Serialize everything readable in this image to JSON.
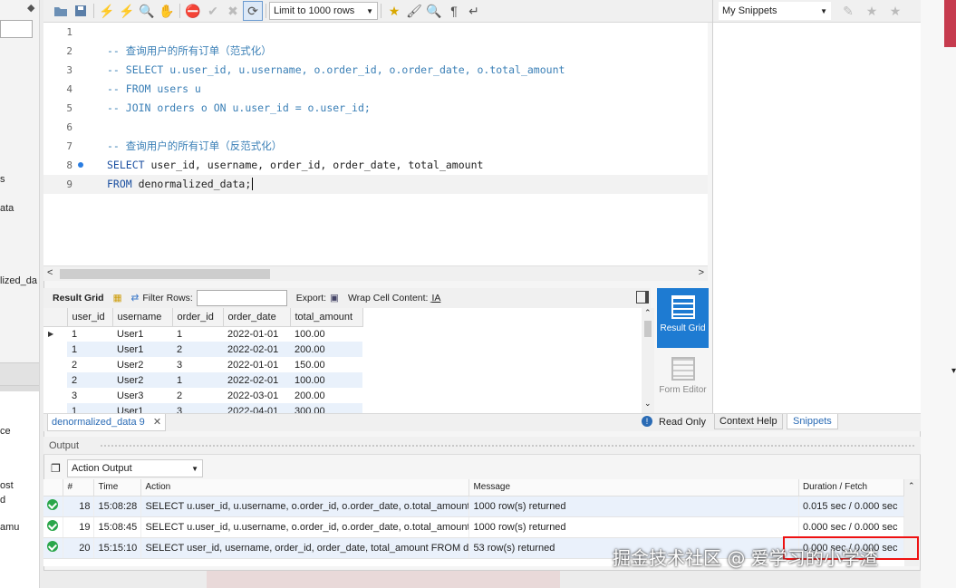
{
  "left_fragments": [
    "s",
    "ata",
    "lized_da",
    "ce",
    "ost",
    "d",
    "amu"
  ],
  "toolbar": {
    "limit_select": "Limit to 1000 rows",
    "snippets_select": "My Snippets"
  },
  "editor": {
    "lines": [
      {
        "n": "1",
        "text": "",
        "type": "plain"
      },
      {
        "n": "2",
        "text": "-- 查询用户的所有订单（范式化）",
        "type": "comment"
      },
      {
        "n": "3",
        "text": "-- SELECT u.user_id, u.username, o.order_id, o.order_date, o.total_amount",
        "type": "comment"
      },
      {
        "n": "4",
        "text": "-- FROM users u",
        "type": "comment"
      },
      {
        "n": "5",
        "text": "-- JOIN orders o ON u.user_id = o.user_id;",
        "type": "comment"
      },
      {
        "n": "6",
        "text": "",
        "type": "plain"
      },
      {
        "n": "7",
        "text": "-- 查询用户的所有订单（反范式化）",
        "type": "comment"
      },
      {
        "n": "8",
        "kw": "SELECT",
        "text": " user_id, username, order_id, order_date, total_amount",
        "type": "sql"
      },
      {
        "n": "9",
        "kw": "FROM",
        "text": " denormalized_data;",
        "type": "sql"
      }
    ]
  },
  "result_bar": {
    "result_grid": "Result Grid",
    "filter_rows": "Filter Rows:",
    "export": "Export:",
    "wrap": "Wrap Cell Content:"
  },
  "grid": {
    "columns": [
      "user_id",
      "username",
      "order_id",
      "order_date",
      "total_amount"
    ],
    "rows": [
      [
        "1",
        "User1",
        "1",
        "2022-01-01",
        "100.00"
      ],
      [
        "1",
        "User1",
        "2",
        "2022-02-01",
        "200.00"
      ],
      [
        "2",
        "User2",
        "3",
        "2022-01-01",
        "150.00"
      ],
      [
        "2",
        "User2",
        "1",
        "2022-02-01",
        "100.00"
      ],
      [
        "3",
        "User3",
        "2",
        "2022-03-01",
        "200.00"
      ],
      [
        "1",
        "User1",
        "3",
        "2022-04-01",
        "300.00"
      ]
    ]
  },
  "side_buttons": {
    "result_grid": "Result Grid",
    "form_editor": "Form Editor"
  },
  "tabs": {
    "query_tab": "denormalized_data 9",
    "read_only": "Read Only",
    "context_help": "Context Help",
    "snippets": "Snippets"
  },
  "output": {
    "header": "Output",
    "action_select": "Action Output",
    "columns": [
      "#",
      "Time",
      "Action",
      "Message",
      "Duration / Fetch"
    ],
    "rows": [
      {
        "num": "18",
        "time": "15:08:28",
        "action": "SELECT u.user_id, u.username, o.order_id, o.order_date, o.total_amount ...",
        "message": "1000 row(s) returned",
        "duration": "0.015 sec / 0.000 sec"
      },
      {
        "num": "19",
        "time": "15:08:45",
        "action": "SELECT u.user_id, u.username, o.order_id, o.order_date, o.total_amount ...",
        "message": "1000 row(s) returned",
        "duration": "0.000 sec / 0.000 sec"
      },
      {
        "num": "20",
        "time": "15:15:10",
        "action": "SELECT user_id, username, order_id, order_date, total_amount FROM d...",
        "message": "53 row(s) returned",
        "duration": "0.000 sec / 0.000 sec"
      }
    ]
  },
  "watermark": "掘金技术社区 @ 爱学习的小学渣",
  "colors": {
    "accent": "#1e7bd2",
    "comment": "#3a7fb6",
    "keyword": "#1b4fa0",
    "highlight_box": "#e11111",
    "success": "#2aa64a"
  }
}
